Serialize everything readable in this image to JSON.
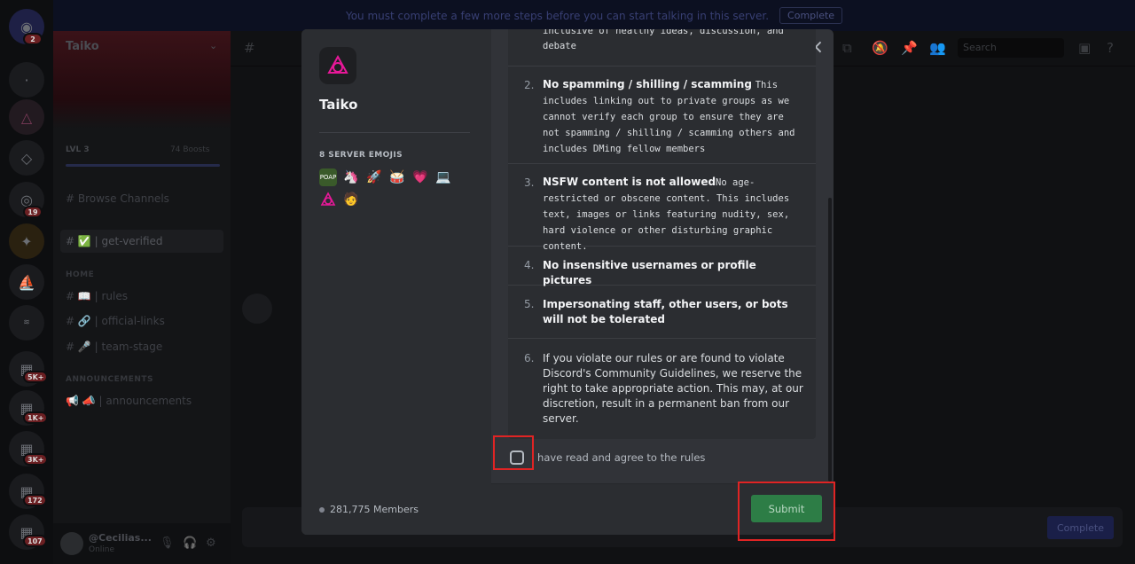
{
  "notice": {
    "text": "You must complete a few more steps before you can start talking in this server.",
    "button": "Complete"
  },
  "rail": {
    "badges": [
      "2",
      "19",
      "5K+",
      "1K+",
      "3K+",
      "172",
      "107"
    ]
  },
  "sidebar": {
    "server_name": "Taiko",
    "level": "LVL 3",
    "boosts": "74 Boosts",
    "browse": "Browse Channels",
    "active_channel": "get-verified",
    "cat1": "HOME",
    "channels": [
      "rules",
      "official-links",
      "team-stage"
    ],
    "cat2": "ANNOUNCEMENTS",
    "announce": "announcements",
    "username": "@Cecilias...",
    "status": "Online"
  },
  "main": {
    "search_placeholder": "Search",
    "complete_label": "Complete"
  },
  "modal": {
    "server_name": "Taiko",
    "emoji_title": "8 SERVER EMOJIS",
    "emojis": [
      "poap-icon",
      "unicorn-icon",
      "rocket-icon",
      "drum-icon",
      "heart-icon",
      "laptop-icon",
      "taiko-icon",
      "person-icon"
    ],
    "members": "281,775 Members",
    "rules": [
      {
        "num": "",
        "title": "",
        "body": "inclusive of healthy ideas, discussion, and debate"
      },
      {
        "num": "2.",
        "title": "No spamming / shilling / scamming",
        "body": "This includes linking out to private groups as we cannot verify each group to ensure they are not spamming / shilling / scamming others and includes DMing fellow members"
      },
      {
        "num": "3.",
        "title": "NSFW content is not allowed",
        "body": "No age-restricted or obscene content. This includes text, images or links featuring nudity, sex, hard violence or other disturbing graphic content."
      },
      {
        "num": "4.",
        "title": "No insensitive usernames or profile pictures",
        "body": ""
      },
      {
        "num": "5.",
        "title": "Impersonating staff, other users, or bots will not be tolerated",
        "body": ""
      },
      {
        "num": "6.",
        "title": "",
        "body": "If you violate our rules or are found to violate Discord's Community Guidelines, we reserve the right to take appropriate action. This may, at our discretion, result in a permanent ban from our server."
      }
    ],
    "agree_label": "I have read and agree to the rules",
    "submit": "Submit"
  },
  "colors": {
    "submit": "#2d7d46",
    "highlight": "#e02424",
    "taiko": "#e81899"
  }
}
